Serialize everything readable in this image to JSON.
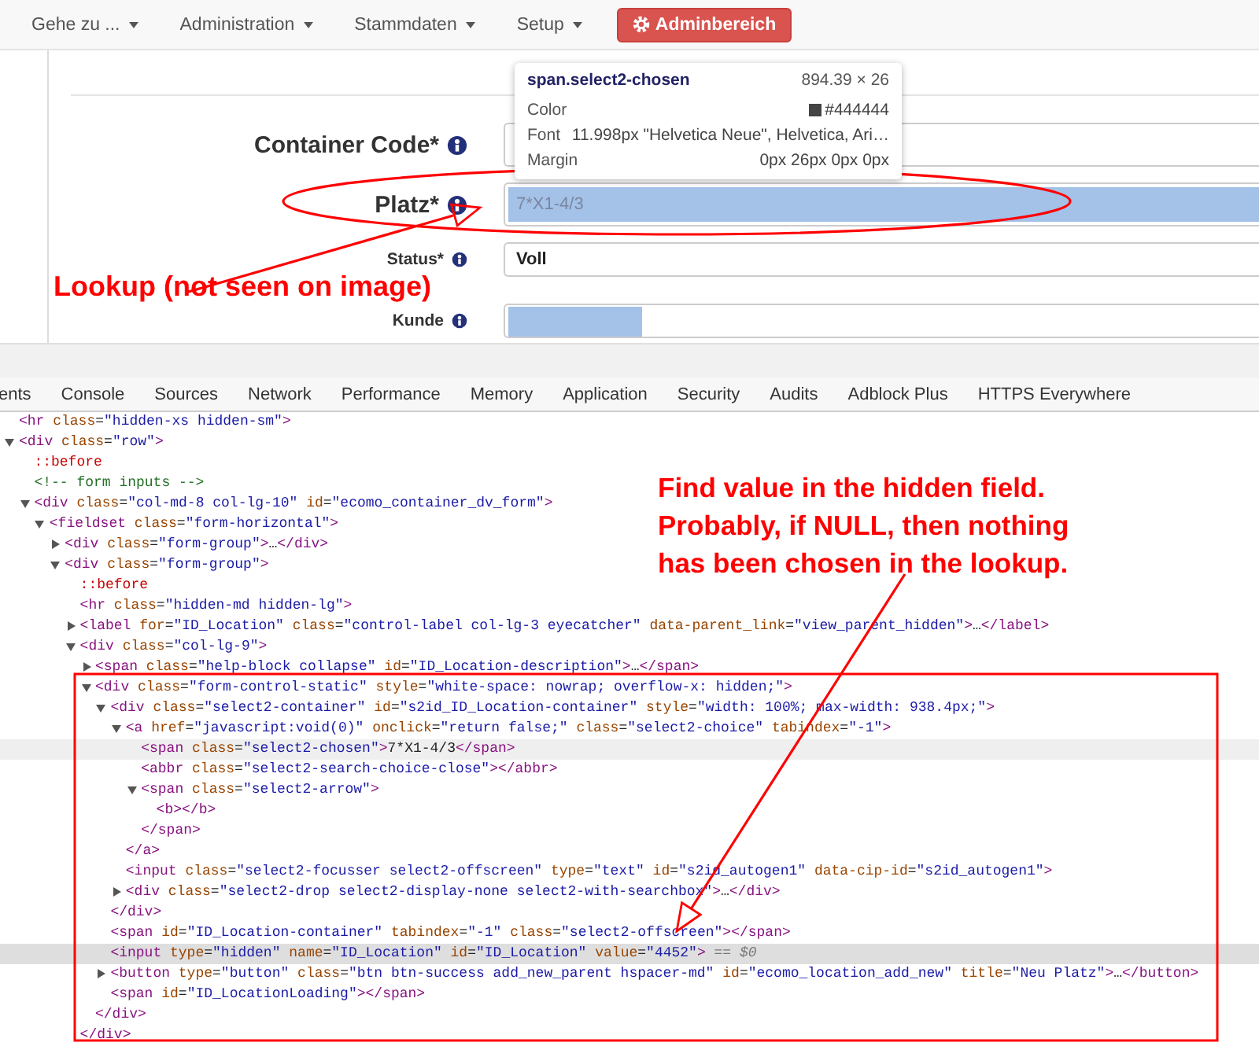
{
  "nav": {
    "items": [
      {
        "label": "Gehe zu ..."
      },
      {
        "label": "Administration"
      },
      {
        "label": "Stammdaten"
      },
      {
        "label": "Setup"
      }
    ],
    "admin_button": "Adminbereich"
  },
  "form": {
    "fields": [
      {
        "kind": "large",
        "label": "Container Code*",
        "highlighted": false
      },
      {
        "kind": "large",
        "label": "Platz*",
        "value": "7*X1-4/3",
        "highlighted": true
      },
      {
        "kind": "small",
        "label": "Status*",
        "value": "Voll",
        "highlighted": false
      },
      {
        "kind": "small",
        "label": "Kunde",
        "highlighted": true
      }
    ]
  },
  "inspector_tooltip": {
    "selector": "span.select2-chosen",
    "size": "894.39 × 26",
    "rows": [
      {
        "name": "Color",
        "value": "#444444",
        "color": "#444444"
      },
      {
        "name": "Font",
        "value": "11.998px \"Helvetica Neue\", Helvetica, Ari…"
      },
      {
        "name": "Margin",
        "value": "0px 26px 0px 0px"
      }
    ]
  },
  "devtools": {
    "tabs": [
      {
        "label": "ents"
      },
      {
        "label": "Console"
      },
      {
        "label": "Sources"
      },
      {
        "label": "Network"
      },
      {
        "label": "Performance"
      },
      {
        "label": "Memory"
      },
      {
        "label": "Application"
      },
      {
        "label": "Security"
      },
      {
        "label": "Audits"
      },
      {
        "label": "Adblock Plus"
      },
      {
        "label": "HTTPS Everywhere"
      }
    ],
    "tree": [
      {
        "kind": "element",
        "markup": "<hr class=\"hidden-xs hidden-sm\">",
        "selected": false,
        "hovered": false
      },
      {
        "kind": "element",
        "markup": "<div class=\"row\">",
        "expanded": true,
        "selected": false,
        "hovered": false,
        "children": [
          {
            "kind": "pseudo",
            "markup": "::before",
            "selected": false,
            "hovered": false
          },
          {
            "kind": "comment",
            "markup": "<!-- form inputs -->",
            "selected": false,
            "hovered": false
          },
          {
            "kind": "element",
            "markup": "<div class=\"col-md-8 col-lg-10\" id=\"ecomo_container_dv_form\">",
            "expanded": true,
            "selected": false,
            "hovered": false,
            "children": [
              {
                "kind": "element",
                "markup": "<fieldset class=\"form-horizontal\">",
                "expanded": true,
                "selected": false,
                "hovered": false,
                "children": [
                  {
                    "kind": "element",
                    "markup": "<div class=\"form-group\">…</div>",
                    "expanded": false,
                    "selected": false,
                    "hovered": false
                  },
                  {
                    "kind": "element",
                    "markup": "<div class=\"form-group\">",
                    "expanded": true,
                    "selected": false,
                    "hovered": false,
                    "children": [
                      {
                        "kind": "pseudo",
                        "markup": "::before",
                        "selected": false,
                        "hovered": false
                      },
                      {
                        "kind": "element",
                        "markup": "<hr class=\"hidden-md hidden-lg\">",
                        "selected": false,
                        "hovered": false
                      },
                      {
                        "kind": "element",
                        "markup": "<label for=\"ID_Location\" class=\"control-label col-lg-3 eyecatcher\" data-parent_link=\"view_parent_hidden\">…</label>",
                        "expanded": false,
                        "selected": false,
                        "hovered": false
                      },
                      {
                        "kind": "element",
                        "markup": "<div class=\"col-lg-9\">",
                        "expanded": true,
                        "selected": false,
                        "hovered": false,
                        "close": "</div>",
                        "children": [
                          {
                            "kind": "element",
                            "markup": "<span class=\"help-block collapse\" id=\"ID_Location-description\">…</span>",
                            "expanded": false,
                            "selected": false,
                            "hovered": false
                          },
                          {
                            "kind": "element",
                            "markup": "<div class=\"form-control-static\" style=\"white-space: nowrap; overflow-x: hidden;\">",
                            "expanded": true,
                            "selected": false,
                            "hovered": false,
                            "close": "</div>",
                            "children": [
                              {
                                "kind": "element",
                                "markup": "<div class=\"select2-container\" id=\"s2id_ID_Location-container\" style=\"width: 100%; max-width: 938.4px;\">",
                                "expanded": true,
                                "selected": false,
                                "hovered": false,
                                "close": "</div>",
                                "children": [
                                  {
                                    "kind": "element",
                                    "markup": "<a href=\"javascript:void(0)\" onclick=\"return false;\" class=\"select2-choice\" tabindex=\"-1\">",
                                    "expanded": true,
                                    "selected": false,
                                    "hovered": false,
                                    "close": "</a>",
                                    "children": [
                                      {
                                        "kind": "element",
                                        "markup": "<span class=\"select2-chosen\">7*X1-4/3</span>",
                                        "selected": false,
                                        "hovered": true
                                      },
                                      {
                                        "kind": "element",
                                        "markup": "<abbr class=\"select2-search-choice-close\"></abbr>",
                                        "selected": false,
                                        "hovered": false
                                      },
                                      {
                                        "kind": "element",
                                        "markup": "<span class=\"select2-arrow\">",
                                        "expanded": true,
                                        "selected": false,
                                        "hovered": false,
                                        "close": "</span>",
                                        "children": [
                                          {
                                            "kind": "element",
                                            "markup": "<b></b>",
                                            "selected": false,
                                            "hovered": false
                                          }
                                        ]
                                      }
                                    ]
                                  },
                                  {
                                    "kind": "element",
                                    "markup": "<input class=\"select2-focusser select2-offscreen\" type=\"text\" id=\"s2id_autogen1\" data-cip-id=\"s2id_autogen1\">",
                                    "selected": false,
                                    "hovered": false
                                  },
                                  {
                                    "kind": "element",
                                    "markup": "<div class=\"select2-drop select2-display-none select2-with-searchbox\">…</div>",
                                    "expanded": false,
                                    "selected": false,
                                    "hovered": false
                                  }
                                ]
                              },
                              {
                                "kind": "element",
                                "markup": "<span id=\"ID_Location-container\" tabindex=\"-1\" class=\"select2-offscreen\"></span>",
                                "selected": false,
                                "hovered": false
                              },
                              {
                                "kind": "element",
                                "markup": "<input type=\"hidden\" name=\"ID_Location\" id=\"ID_Location\" value=\"4452\">",
                                "console_ref": "== $0",
                                "selected": true,
                                "hovered": false
                              },
                              {
                                "kind": "element",
                                "markup": "<button type=\"button\" class=\"btn btn-success add_new_parent hspacer-md\" id=\"ecomo_location_add_new\" title=\"Neu Platz\">…</button>",
                                "expanded": false,
                                "selected": false,
                                "hovered": false
                              },
                              {
                                "kind": "element",
                                "markup": "<span id=\"ID_LocationLoading\"></span>",
                                "selected": false,
                                "hovered": false
                              }
                            ]
                          }
                        ]
                      }
                    ]
                  }
                ]
              }
            ]
          }
        ]
      }
    ]
  },
  "annotations": [
    {
      "kind": "lookup",
      "lines": [
        "Lookup (not seen on image)"
      ]
    },
    {
      "kind": "hint",
      "lines": [
        "Find value in the hidden field.",
        "Probably, if NULL, then nothing",
        "has been chosen in the lookup."
      ]
    }
  ]
}
